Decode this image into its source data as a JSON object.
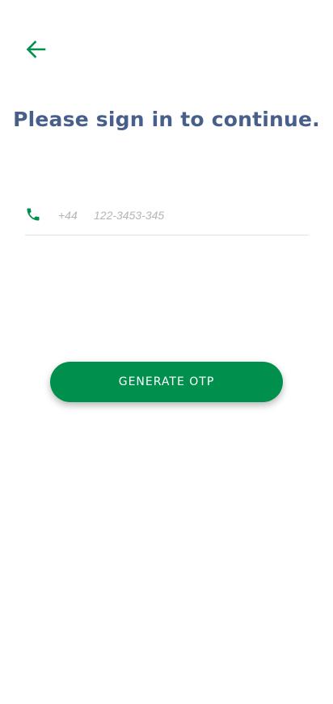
{
  "header": {
    "back_icon": "arrow-left-icon"
  },
  "main": {
    "title": "Please sign in to continue.",
    "phone": {
      "icon": "phone-icon",
      "country_code": "+44",
      "value": "",
      "placeholder": "122-3453-345"
    },
    "generate_button_label": "GENERATE OTP"
  },
  "colors": {
    "accent": "#008f4c",
    "title": "#475f8a",
    "placeholder": "#b5b5b5",
    "divider": "#e2e2e2",
    "background": "#ffffff"
  }
}
